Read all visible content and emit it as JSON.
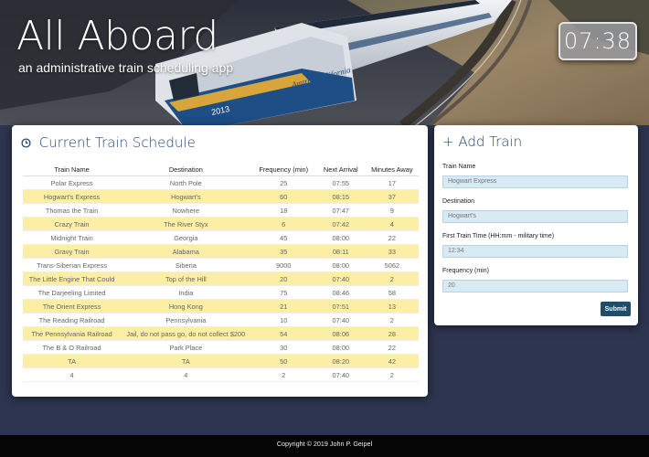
{
  "header": {
    "title": "All Aboard",
    "subtitle": "an administrative train scheduling app",
    "clock": "07:38",
    "train_logo_text": "Amtrak California",
    "train_number": "2013"
  },
  "schedule": {
    "title": "Current Train Schedule",
    "title_icon": "clock-icon",
    "columns": [
      "Train Name",
      "Destination",
      "Frequency (min)",
      "Next Arrival",
      "Minutes Away"
    ],
    "rows": [
      [
        "Polar Express",
        "North Pole",
        "25",
        "07:55",
        "17"
      ],
      [
        "Hogwart's Express",
        "Hogwart's",
        "60",
        "08:15",
        "37"
      ],
      [
        "Thomas the Train",
        "Nowhere",
        "18",
        "07:47",
        "9"
      ],
      [
        "Crazy Train",
        "The River Styx",
        "6",
        "07:42",
        "4"
      ],
      [
        "Midnight Train",
        "Georgia",
        "45",
        "08:00",
        "22"
      ],
      [
        "Gravy Train",
        "Alabama",
        "35",
        "08:11",
        "33"
      ],
      [
        "Trans-Siberian Express",
        "Siberia",
        "9000",
        "08:00",
        "5062"
      ],
      [
        "The Little Engine That Could",
        "Top of the Hill",
        "20",
        "07:40",
        "2"
      ],
      [
        "The Darjeeling Limited",
        "India",
        "75",
        "08:46",
        "58"
      ],
      [
        "The Orient Express",
        "Hong Kong",
        "21",
        "07:51",
        "13"
      ],
      [
        "The Reading Railroad",
        "Pennsylvania",
        "10",
        "07:40",
        "2"
      ],
      [
        "The Pennsylvania Railroad",
        "Jail, do not pass go, do not collect $200",
        "54",
        "08:06",
        "28"
      ],
      [
        "The B & O Railroad",
        "Park Place",
        "30",
        "08:00",
        "22"
      ],
      [
        "TA",
        "TA",
        "50",
        "08:20",
        "42"
      ],
      [
        "4",
        "4",
        "2",
        "07:40",
        "2"
      ]
    ],
    "stripe_color": "#fdeea5"
  },
  "add_train": {
    "title": "+ Add Train",
    "fields": [
      {
        "label": "Train Name",
        "placeholder": "Hogwart Express"
      },
      {
        "label": "Destination",
        "placeholder": "Hogwart's"
      },
      {
        "label": "First Train Time (HH:mm - military time)",
        "placeholder": "12:34"
      },
      {
        "label": "Frequency (min)",
        "placeholder": "20"
      }
    ],
    "submit_label": "Submit"
  },
  "footer": {
    "copyright": "Copyright © 2019 John P. Geipel"
  },
  "colors": {
    "page_background": "#2e3550",
    "panel_title": "#24456e",
    "input_background": "#d8eaf3",
    "submit_button": "#1f4e6b",
    "footer_background": "#050505"
  }
}
